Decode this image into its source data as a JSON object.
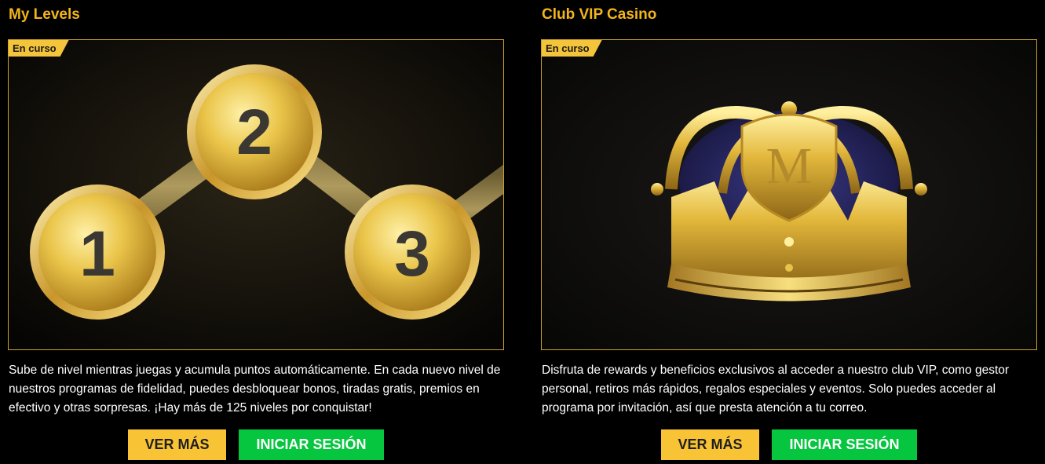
{
  "cards": [
    {
      "title": "My Levels",
      "badge": "En curso",
      "coins": [
        "1",
        "2",
        "3"
      ],
      "description": "Sube de nivel mientras juegas y acumula puntos automáticamente. En cada nuevo nivel de nuestros programas de fidelidad, puedes desbloquear bonos, tiradas gratis, premios en efectivo y otras sorpresas. ¡Hay más de 125 niveles por conquistar!",
      "more_label": "VER MÁS",
      "login_label": "INICIAR SESIÓN"
    },
    {
      "title": "Club VIP Casino",
      "badge": "En curso",
      "crown_letter": "M",
      "description": "Disfruta de rewards y beneficios exclusivos al acceder a nuestro club VIP, como gestor personal, retiros más rápidos, regalos especiales y eventos. Solo puedes acceder al programa por invitación, así que presta atención a tu correo.",
      "more_label": "VER MÁS",
      "login_label": "INICIAR SESIÓN"
    }
  ],
  "colors": {
    "title": "#f2b51c",
    "badge": "#f4c43a",
    "more_button": "#f8c334",
    "login_button": "#06c53f",
    "gold": "#e2b93b"
  }
}
